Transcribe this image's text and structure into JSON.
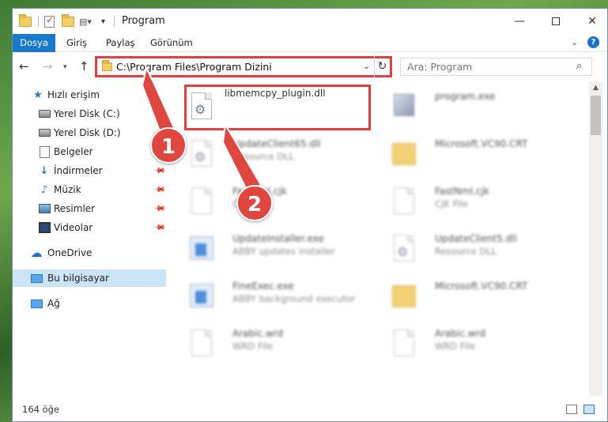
{
  "window": {
    "title": "Program",
    "min_label": "—",
    "close_label": "✕"
  },
  "ribbon": {
    "tabs": [
      "Dosya",
      "Giriş",
      "Paylaş",
      "Görünüm"
    ],
    "help": "?"
  },
  "address": {
    "path": "C:\\Program Files\\Program Dizini"
  },
  "search": {
    "placeholder": "Ara: Program"
  },
  "navpane": {
    "quick_access": "Hızlı erişim",
    "items": [
      {
        "label": "Yerel Disk (C:)",
        "icon": "drive-icon"
      },
      {
        "label": "Yerel Disk (D:)",
        "icon": "drive-icon"
      },
      {
        "label": "Belgeler",
        "icon": "documents-icon"
      },
      {
        "label": "İndirmeler",
        "icon": "downloads-icon"
      },
      {
        "label": "Müzik",
        "icon": "music-icon"
      },
      {
        "label": "Resimler",
        "icon": "pictures-icon"
      },
      {
        "label": "Videolar",
        "icon": "videos-icon"
      }
    ],
    "onedrive": "OneDrive",
    "this_pc": "Bu bilgisayar",
    "network": "Ağ"
  },
  "files": [
    {
      "name": "libmemcpy_plugin.dll",
      "type": "",
      "icon": "dll-gear-icon",
      "highlighted": true
    },
    {
      "name": "program.exe",
      "type": "",
      "icon": "exe-icon"
    },
    {
      "name": "UpdateClient65.dll",
      "type": "Resource DLL",
      "icon": "dll-gear-icon"
    },
    {
      "name": "Microsoft.VC90.CRT",
      "type": "",
      "icon": "folder-icon"
    },
    {
      "name": "FastNml.cjk",
      "type": "CJK File",
      "icon": "file-icon"
    },
    {
      "name": "FastNml.cjk",
      "type": "CJK File",
      "icon": "file-icon"
    },
    {
      "name": "UpdateInstaller.exe",
      "type": "ABBY updates installer",
      "icon": "exe-icon"
    },
    {
      "name": "UpdateClient5.dll",
      "type": "Resource DLL",
      "icon": "dll-gear-icon"
    },
    {
      "name": "FineExec.exe",
      "type": "ABBY background executor",
      "icon": "exe-icon"
    },
    {
      "name": "Microsoft.VC90.CRT",
      "type": "",
      "icon": "folder-icon"
    },
    {
      "name": "Arabic.wrd",
      "type": "WRD File",
      "icon": "file-icon"
    },
    {
      "name": "Arabic.wrd",
      "type": "WRD File",
      "icon": "file-icon"
    }
  ],
  "status": {
    "count": "164 öğe"
  },
  "annotations": {
    "step1": "1",
    "step2": "2",
    "arrow_color": "#e0463e"
  }
}
